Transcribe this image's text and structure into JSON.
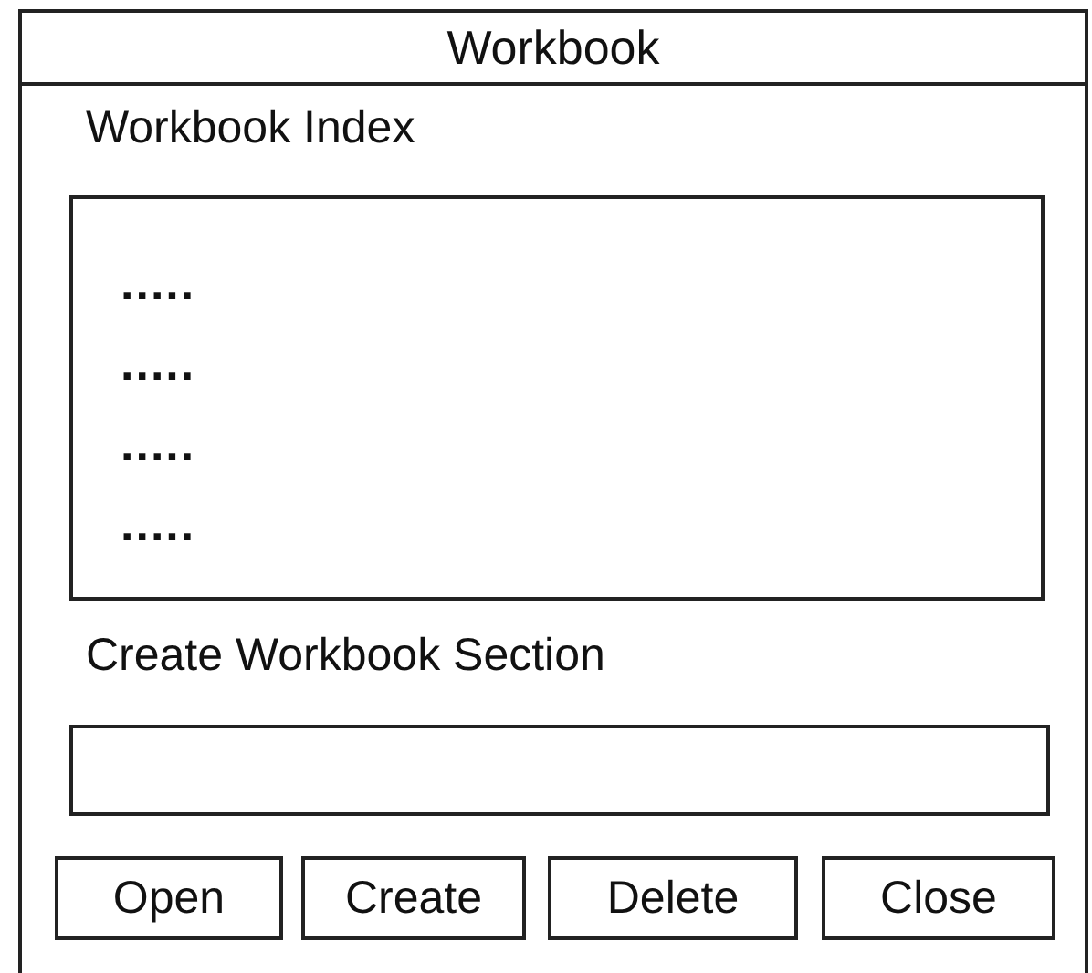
{
  "window": {
    "title": "Workbook"
  },
  "index": {
    "label": "Workbook Index",
    "items": [
      {
        "text": "....."
      },
      {
        "text": "....."
      },
      {
        "text": "....."
      },
      {
        "text": "....."
      }
    ]
  },
  "section": {
    "label": "Create Workbook Section"
  },
  "buttons": [
    {
      "label": "Open"
    },
    {
      "label": "Create"
    },
    {
      "label": "Delete"
    },
    {
      "label": "Close"
    }
  ]
}
